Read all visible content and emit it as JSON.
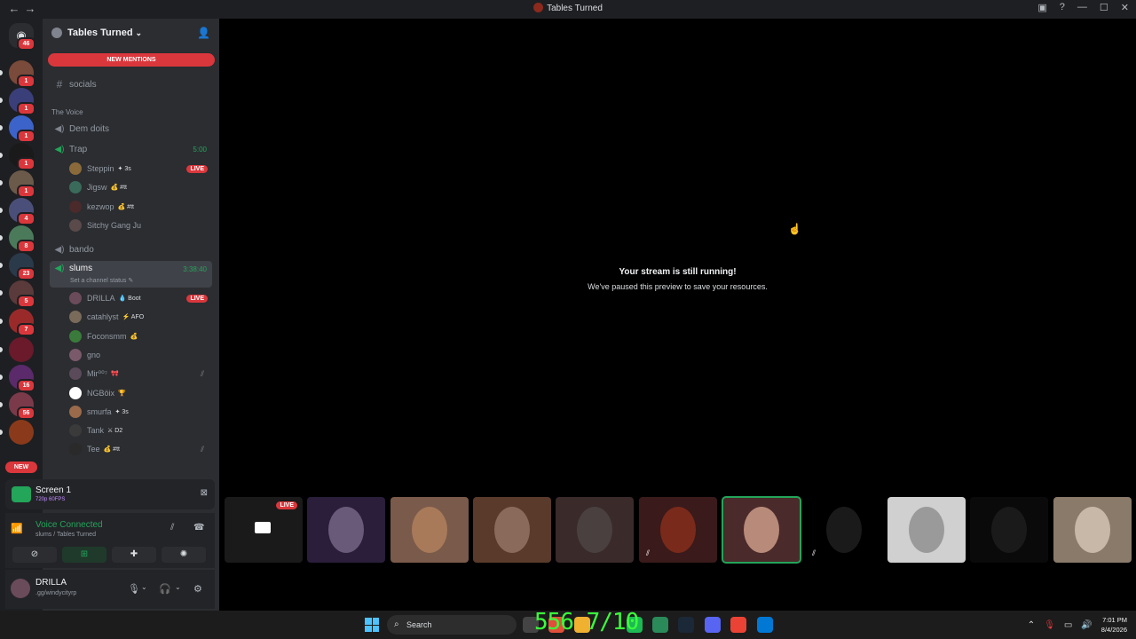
{
  "titlebar": {
    "title": "Tables Turned",
    "back": "←",
    "forward": "→",
    "inbox_icon": "▣",
    "help_icon": "?",
    "minimize": "—",
    "maximize": "☐",
    "close": "✕"
  },
  "servers": {
    "home_badge": "46",
    "items": [
      {
        "color": "#7a4a3a",
        "badge": "1"
      },
      {
        "color": "#3a3f7a",
        "badge": "1"
      },
      {
        "color": "#3b63c9",
        "badge": "1"
      },
      {
        "color": "#1a1a1a",
        "badge": "1"
      },
      {
        "color": "#6b5a4a",
        "badge": "1"
      },
      {
        "color": "#4a4f7a",
        "badge": "4"
      },
      {
        "color": "#4a7a5a",
        "badge": "8"
      },
      {
        "color": "#2a3a4a",
        "badge": "23"
      },
      {
        "color": "#5a3a3a",
        "badge": "5"
      },
      {
        "color": "#9a2a2a",
        "badge": "7"
      },
      {
        "color": "#6a1a2a",
        "badge": ""
      },
      {
        "color": "#5a2a6a",
        "badge": "16"
      },
      {
        "color": "#7a3a4a",
        "badge": "56"
      },
      {
        "color": "#8a3a1a",
        "badge": ""
      }
    ],
    "new_badge": "NEW"
  },
  "sidebar": {
    "server_name": "Tables Turned",
    "chevron": "⌄",
    "add_person_icon": "👤",
    "new_mentions": "NEW MENTIONS",
    "channel_socials": "socials",
    "category": "The Voice",
    "channels": {
      "dem_doits": "Dem doits",
      "trap": "Trap",
      "trap_timer": "5:00",
      "bando": "bando",
      "slums": "slums",
      "slums_timer": "3:38:40",
      "slums_status": "Set a channel status ✎"
    },
    "trap_users": [
      {
        "name": "Steppin",
        "tag": "✦ 3s",
        "live": "LIVE",
        "color": "#8a6a3a"
      },
      {
        "name": "Jigsw",
        "tag": "💰 #tt",
        "color": "#3a6a5a"
      },
      {
        "name": "kezwop",
        "tag": "💰 #tt",
        "color": "#4a2a2a"
      },
      {
        "name": "Sitchy Gang Ju",
        "tag": "",
        "color": "#5a4a4a"
      }
    ],
    "slums_users": [
      {
        "name": "DRILLA",
        "tag": "💧 Boot",
        "live": "LIVE",
        "color": "#6a4b5a"
      },
      {
        "name": "catahlyst",
        "tag": "⚡ AFO",
        "color": "#7a6a5a"
      },
      {
        "name": "Foconsmm",
        "tag": "💰",
        "color": "#3a7a3a"
      },
      {
        "name": "gno",
        "tag": "",
        "color": "#7a5a6a"
      },
      {
        "name": "Mir⁰⁰⁷",
        "tag": "🎀",
        "color": "#5a4a5a",
        "muted": true
      },
      {
        "name": "NGBöix",
        "tag": "🏆",
        "color": "#ffffff"
      },
      {
        "name": "smurfa",
        "tag": "✦ 3s",
        "color": "#9a6a4a"
      },
      {
        "name": "Tank",
        "tag": "⚔ D2",
        "color": "#3a3a3a"
      },
      {
        "name": "Tee",
        "tag": "💰 #tt",
        "color": "#2a2a2a",
        "muted": true
      }
    ]
  },
  "screen_panel": {
    "title": "Screen 1",
    "quality": "720p 60FPS"
  },
  "voice_panel": {
    "status": "Voice Connected",
    "location": "slums / Tables Turned"
  },
  "user_panel": {
    "name": "DRILLA",
    "status": ".gg/windycityrp"
  },
  "stream": {
    "paused_title": "Your stream is still running!",
    "paused_subtitle": "We've paused this preview to save your resources."
  },
  "tiles": [
    {
      "bg": "#1a1a1a",
      "circle": "",
      "live": "LIVE",
      "monitor": true
    },
    {
      "bg": "#2a1e3a",
      "circle": "#6a5a7a"
    },
    {
      "bg": "#7a5a4a",
      "circle": "#a87a5a"
    },
    {
      "bg": "#5a3a2a",
      "circle": "#8a6a5a"
    },
    {
      "bg": "#3a2a2a",
      "circle": "#4a4040"
    },
    {
      "bg": "#3a1a1a",
      "circle": "#7a2a1a",
      "muted": true
    },
    {
      "bg": "#4a2a2a",
      "circle": "#b88a7a",
      "selected": true
    },
    {
      "bg": "#000000",
      "circle": "#1a1a1a",
      "muted": true
    },
    {
      "bg": "#d0d0d0",
      "circle": "#9a9a9a"
    },
    {
      "bg": "#0a0a0a",
      "circle": "#1a1a1a"
    },
    {
      "bg": "#8a7a6a",
      "circle": "#c8b8a8"
    }
  ],
  "taskbar": {
    "search": "Search",
    "overlay_text": "556 7/10",
    "time": "7:01 PM",
    "date": "8/4/2026",
    "apps": [
      "#e04f3a",
      "#f0b030",
      "#1db954",
      "#2a8a5a",
      "#1b2838",
      "#5865f2",
      "#ea4335",
      "#0078d4"
    ]
  }
}
